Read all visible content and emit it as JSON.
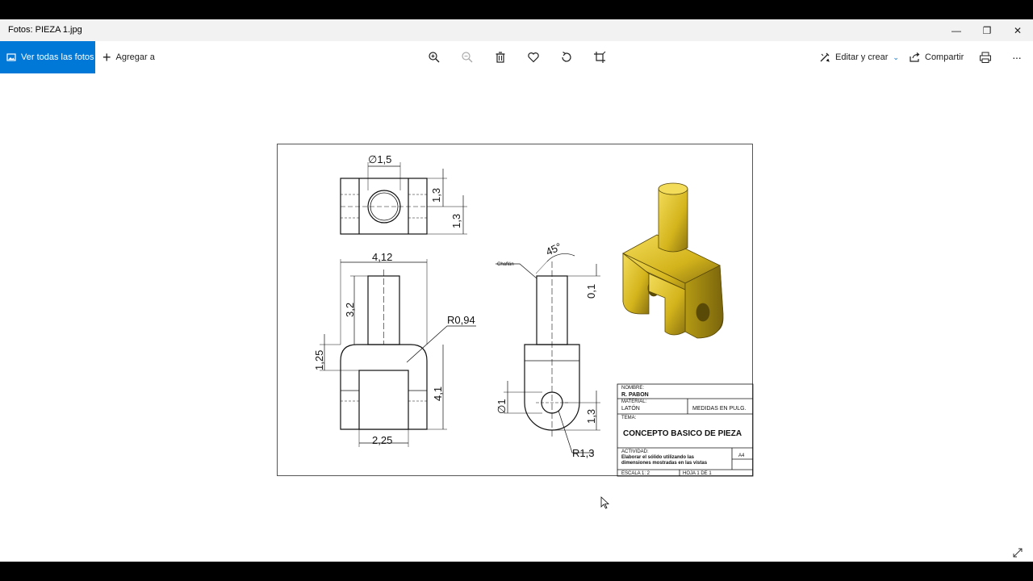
{
  "window": {
    "title": "Fotos: PIEZA 1.jpg",
    "minimize_glyph": "—",
    "restore_glyph": "❐",
    "close_glyph": "✕"
  },
  "toolbar": {
    "view_all_label": "Ver todas las fotos",
    "add_to_label": "Agregar a",
    "edit_create_label": "Editar y crear",
    "share_label": "Compartir",
    "more_glyph": "···",
    "icons": [
      "zoom-in-icon",
      "zoom-out-icon",
      "delete-icon",
      "heart-icon",
      "rotate-icon",
      "crop-icon",
      "print-icon"
    ],
    "accent_color": "#0078d7"
  },
  "drawing": {
    "dimensions": {
      "top_diameter": "∅1,5",
      "top_h1": "1,3",
      "top_h2": "1,3",
      "front_width": "4,12",
      "front_pin_h": "3,2",
      "front_left": "1,25",
      "front_radius": "R0,94",
      "front_height": "4,1",
      "front_slot": "2,25",
      "side_angle": "45°",
      "side_chamfer": "Chaflán",
      "side_chamfer_size": "0,1",
      "side_hole": "∅1",
      "side_hole_h": "1,3",
      "side_radius": "R1,3"
    },
    "title_block": {
      "name_label": "NOMBRE:",
      "name_value": "R. PABON",
      "material_label": "MATERIAL:",
      "material_value": "LATÓN",
      "units": "MEDIDAS EN PULG.",
      "theme_label": "TEMA:",
      "theme_value": "CONCEPTO BASICO DE PIEZA",
      "activity_label": "ACTIVIDAD:",
      "activity_line1": "Elaborar el sólido utilizando las",
      "activity_line2": "dimensiones mostradas en las vistas",
      "sheet_size": "A4",
      "scale": "ESCALA 1: 2",
      "sheet": "HOJA 1 DE 1"
    },
    "part_color": "#d4b41c"
  }
}
